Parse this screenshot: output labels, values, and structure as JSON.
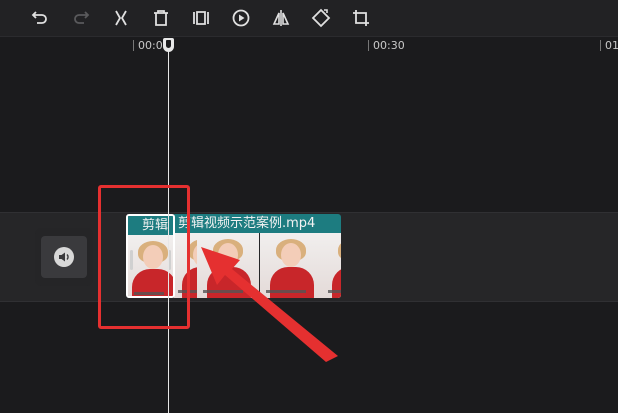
{
  "toolbar": {
    "buttons": [
      {
        "name": "undo-button",
        "icon": "undo-icon"
      },
      {
        "name": "redo-button",
        "icon": "redo-icon",
        "disabled": true
      },
      {
        "name": "split-button",
        "icon": "split-icon"
      },
      {
        "name": "delete-button",
        "icon": "delete-icon"
      },
      {
        "name": "freeze-frame-button",
        "icon": "freeze-icon"
      },
      {
        "name": "play-speed-button",
        "icon": "play-circle-icon"
      },
      {
        "name": "mirror-button",
        "icon": "mirror-icon"
      },
      {
        "name": "rotate-button",
        "icon": "rotate-icon"
      },
      {
        "name": "crop-button",
        "icon": "crop-icon"
      }
    ]
  },
  "ruler": {
    "labels": [
      "00:00",
      "00:30",
      "01"
    ]
  },
  "track": {
    "audio_icon": "speaker-icon",
    "split_clip_title": "剪辑",
    "main_clip_title": "剪辑视频示范案例.mp4"
  },
  "colors": {
    "background": "#1b1b1d",
    "clip_header": "#1d7c80",
    "annotation": "#e53030"
  }
}
